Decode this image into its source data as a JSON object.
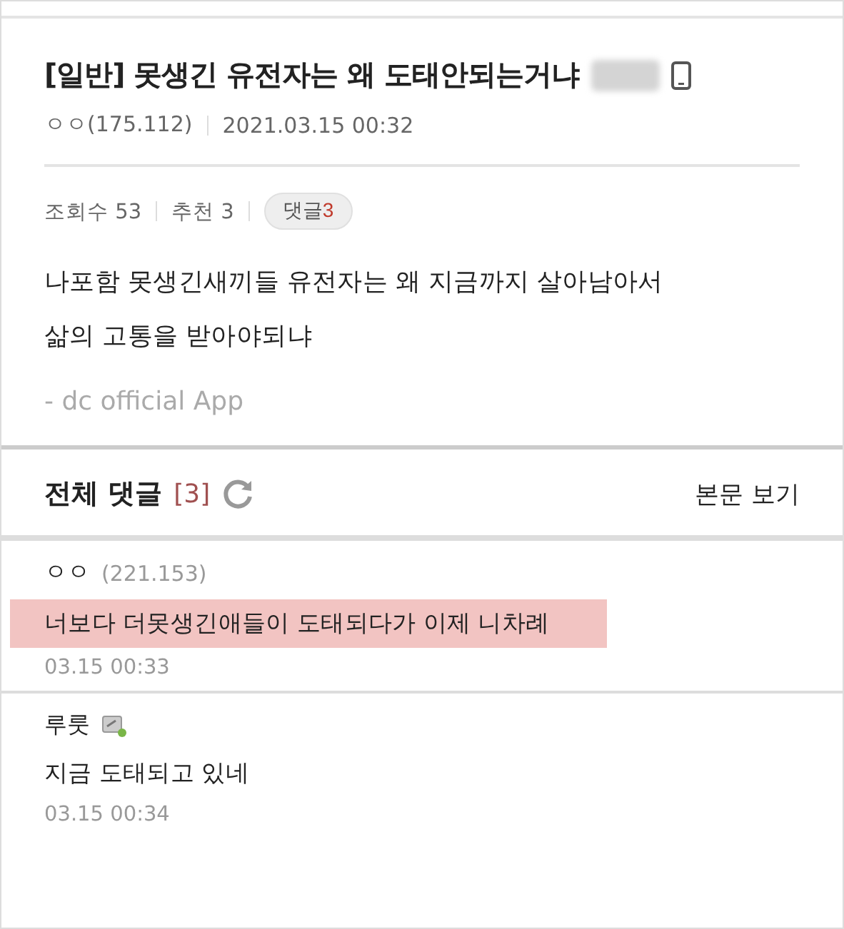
{
  "post": {
    "title": "[일반] 못생긴 유전자는 왜 도태안되는거냐",
    "title_redacted": true,
    "author": "ㅇㅇ(175.112)",
    "date": "2021.03.15 00:32",
    "views": "조회수 53",
    "recommends": "추천 3",
    "comments_label": "댓글",
    "comments_count": "3",
    "body": [
      "나포함 못생긴새끼들 유전자는 왜 지금까지 살아남아서",
      "삶의 고통을 받아야되냐"
    ],
    "signature": "- dc official App"
  },
  "comments_header": {
    "title": "전체 댓글",
    "count": "[3]",
    "view_post": "본문 보기"
  },
  "comments": [
    {
      "author": "ㅇㅇ",
      "ip": "(221.153)",
      "text": "너보다 더못생긴애들이 도태되다가 이제 니차례",
      "time": "03.15 00:33",
      "highlighted": true,
      "member_icon": false
    },
    {
      "author": "루룻",
      "text": "지금 도태되고 있네",
      "time": "03.15 00:34",
      "highlighted": false,
      "member_icon": true
    }
  ]
}
